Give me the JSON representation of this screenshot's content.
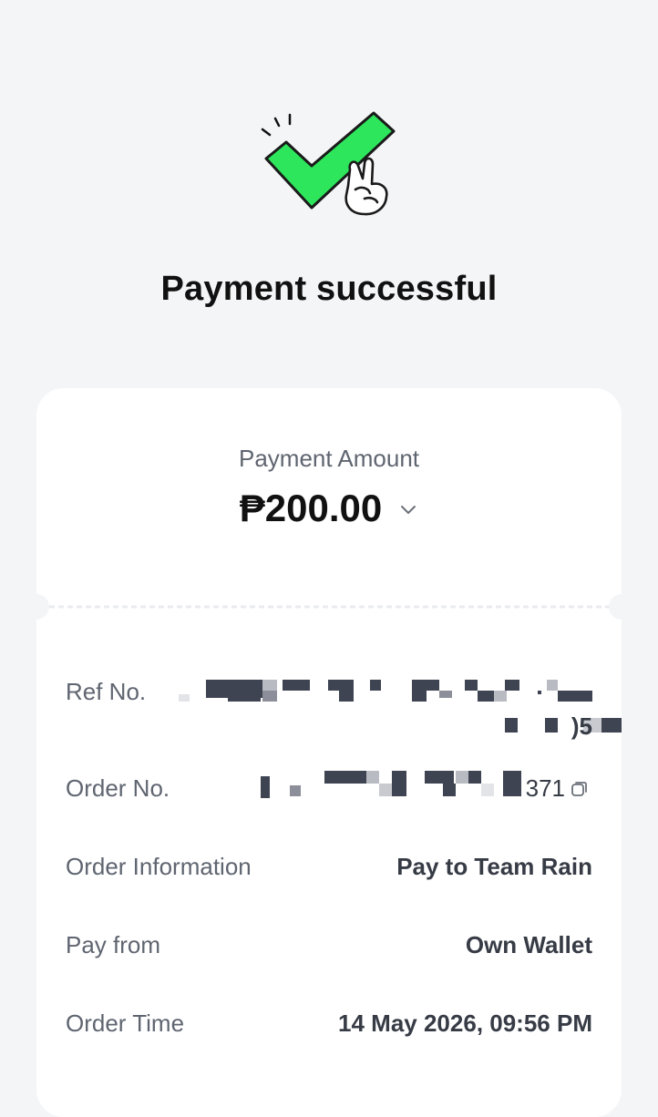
{
  "status": {
    "title": "Payment successful",
    "illustration": "checkmark-peace-sign-icon"
  },
  "amount": {
    "label": "Payment Amount",
    "value": "₱200.00",
    "expand_icon": "chevron-down-icon"
  },
  "details": {
    "ref_no": {
      "label": "Ref No.",
      "value_tail": ")5"
    },
    "order_no": {
      "label": "Order No.",
      "value_tail": "371",
      "copy_icon": "copy-icon"
    },
    "order_information": {
      "label": "Order Information",
      "value": "Pay to Team Rain"
    },
    "pay_from": {
      "label": "Pay from",
      "value": "Own Wallet"
    },
    "order_time": {
      "label": "Order Time",
      "value": "14 May 2026, 09:56 PM"
    }
  },
  "colors": {
    "background": "#f4f5f7",
    "card": "#ffffff",
    "check_green": "#2ee65c",
    "text_primary": "#111111",
    "text_secondary": "#5f6570",
    "text_value": "#363b45"
  }
}
